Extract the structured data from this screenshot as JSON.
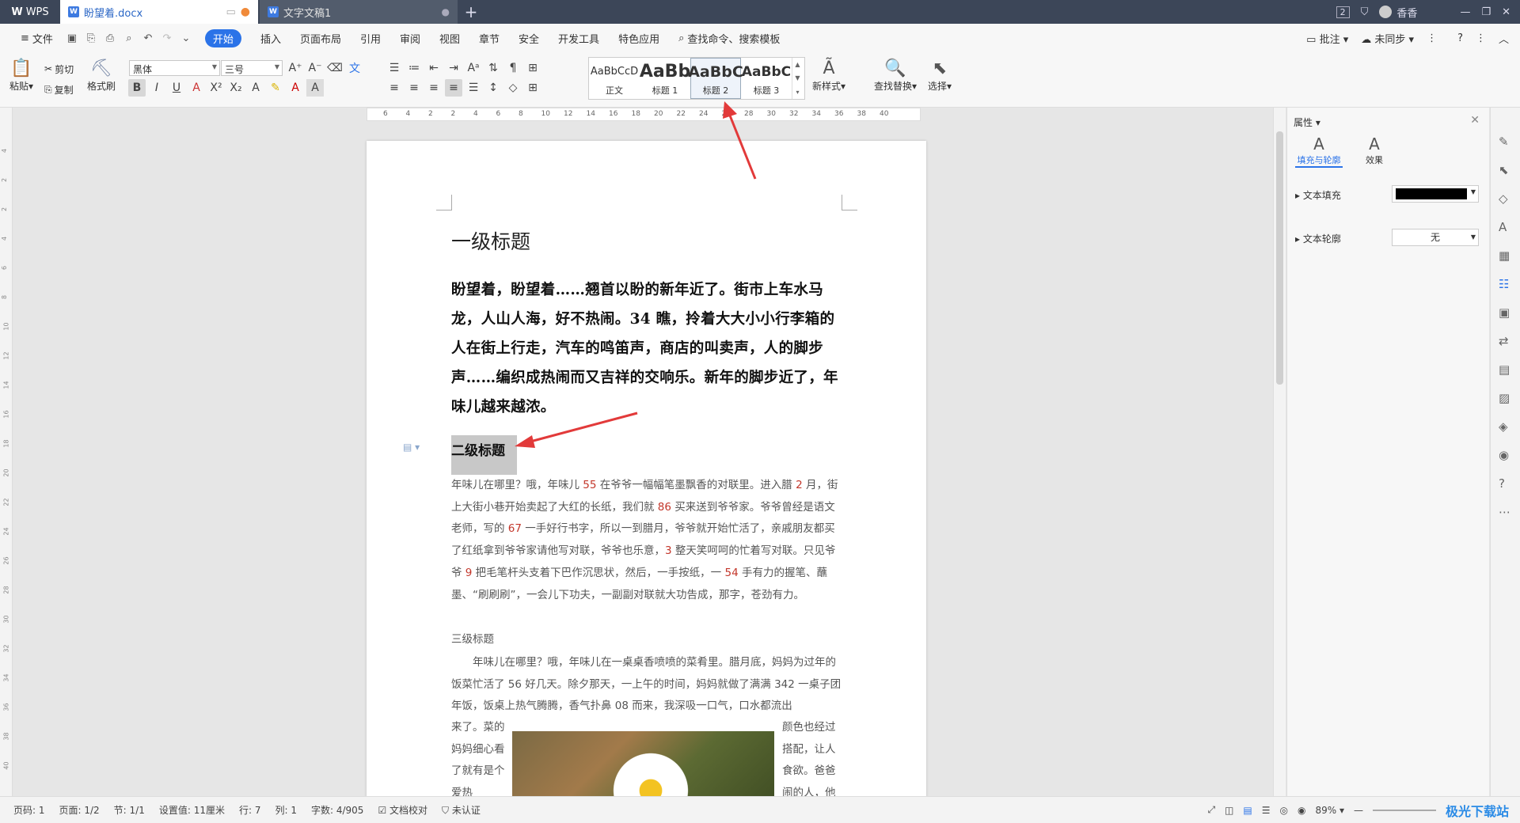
{
  "titlebar": {
    "logo": "WPS",
    "tabs": [
      {
        "title": "盼望着.docx"
      },
      {
        "title": "文字文稿1"
      }
    ],
    "badge": "2",
    "user": "香香"
  },
  "menubar": {
    "file": "文件",
    "items": [
      "开始",
      "插入",
      "页面布局",
      "引用",
      "审阅",
      "视图",
      "章节",
      "安全",
      "开发工具",
      "特色应用"
    ],
    "search": "查找命令、搜索模板",
    "comment": "批注",
    "sync": "未同步"
  },
  "ribbon": {
    "paste": "粘贴",
    "cut": "剪切",
    "copy": "复制",
    "format_painter": "格式刷",
    "font_name": "黑体",
    "font_size": "三号",
    "styles": [
      {
        "preview": "AaBbCcD",
        "label": "正文"
      },
      {
        "preview": "AaBb",
        "label": "标题 1"
      },
      {
        "preview": "AaBbC",
        "label": "标题 2"
      },
      {
        "preview": "AaBbC",
        "label": "标题 3"
      }
    ],
    "new_style": "新样式",
    "find_replace": "查找替换",
    "select": "选择"
  },
  "ruler": {
    "ticks": [
      "6",
      "4",
      "2",
      "2",
      "4",
      "6",
      "8",
      "10",
      "12",
      "14",
      "16",
      "18",
      "20",
      "22",
      "24",
      "26",
      "28",
      "30",
      "32",
      "34",
      "36",
      "38",
      "40"
    ],
    "vticks": [
      "4",
      "2",
      "2",
      "4",
      "6",
      "8",
      "10",
      "12",
      "14",
      "16",
      "18",
      "20",
      "22",
      "24",
      "26",
      "28",
      "30",
      "32",
      "34",
      "36",
      "38",
      "40"
    ]
  },
  "document": {
    "heading1": "一级标题",
    "bold_paragraph": "盼望着，盼望着……翘首以盼的新年近了。街市上车水马龙，人山人海，好不热闹。34 瞧，拎着大大小小行李箱的人在街上行走，汽车的鸣笛声，商店的叫卖声，人的脚步声……编织成热闹而又吉祥的交响乐。新年的脚步近了，年味儿越来越浓。",
    "heading2": "二级标题",
    "para1": [
      {
        "t": "年味儿在哪里？哦，年味儿 "
      },
      {
        "n": "55"
      },
      {
        "t": " 在爷爷一幅幅笔墨飘香的对联里。进入腊 "
      },
      {
        "n": "2"
      },
      {
        "t": " 月，街上大街小巷开始卖起了大红的长纸，我们就 "
      },
      {
        "n": "86"
      },
      {
        "t": " 买来送到爷爷家。爷爷曾经是语文老师，写的 "
      },
      {
        "n": "67"
      },
      {
        "t": " 一手好行书字，所以一到腊月，爷爷就开始忙活了，亲戚朋友都买了红纸拿到爷爷家请他写对联，爷爷也乐意，"
      },
      {
        "n": "3"
      },
      {
        "t": " 整天笑呵呵的忙着写对联。只见爷爷 "
      },
      {
        "n": "9"
      },
      {
        "t": " 把毛笔杆头支着下巴作沉思状，然后，一手按纸，一 "
      },
      {
        "n": "54"
      },
      {
        "t": " 手有力的握笔、蘸墨、“刷刷刷”，一会儿下功夫，一副副对联就大功告成，那字，苍劲有力。"
      }
    ],
    "heading3": "三级标题",
    "para2": [
      {
        "t": "　　年味儿在哪里？哦，年味儿在一桌桌香喷喷的菜肴里。腊月底，妈妈为过年的饭菜忙活了 "
      },
      {
        "n": "56"
      },
      {
        "t": " 好几天。除夕那天，一上午的时间，妈妈就做了满满 "
      },
      {
        "n": "342"
      },
      {
        "t": " 一桌子团年饭，饭桌上热气腾腾，香气扑鼻 "
      },
      {
        "n": "08"
      },
      {
        "t": " 而来，我深吸一口气，口水都流出"
      }
    ],
    "col_left": "来了。菜的妈妈细心看了就有是个爱热",
    "col_right": "颜色也经过搭配，让人食欲。爸爸闹的人，他"
  },
  "properties": {
    "title": "属性",
    "tab_fill": "填充与轮廓",
    "tab_effect": "效果",
    "text_fill": "文本填充",
    "text_outline": "文本轮廓",
    "outline_value": "无",
    "fill_color": "#000000"
  },
  "status": {
    "page_num": "页码: 1",
    "pages": "页面: 1/2",
    "section": "节: 1/1",
    "setting": "设置值: 11厘米",
    "row": "行: 7",
    "col": "列: 1",
    "words": "字数: 4/905",
    "proof": "文档校对",
    "auth": "未认证",
    "zoom": "89%",
    "watermark": "极光下载站"
  }
}
